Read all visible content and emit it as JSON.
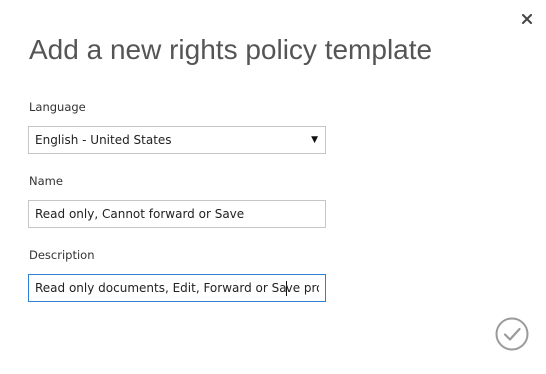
{
  "dialog": {
    "title": "Add a new rights policy template",
    "close_icon": "close-icon",
    "confirm_icon": "checkmark-circle-icon"
  },
  "language": {
    "label": "Language",
    "selected": "English - United States",
    "arrow_icon": "dropdown-arrow-icon"
  },
  "name": {
    "label": "Name",
    "value": "Read only, Cannot forward or Save"
  },
  "description": {
    "label": "Description",
    "value_before_caret": "Read only documents, Edit, Forward or Sa",
    "value_after_caret": "ve prohil"
  },
  "colors": {
    "focus_border": "#2f7fd6",
    "field_border": "#c6c6c6",
    "title_text": "#555555",
    "confirm_icon": "#9a9a9a"
  }
}
